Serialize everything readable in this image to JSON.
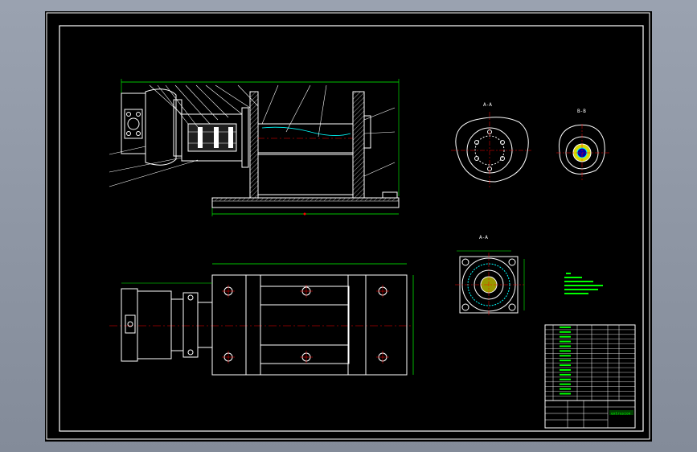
{
  "sheet": {
    "background": "#000000",
    "frame_color": "#ffffff",
    "outline_color": "#ffffff",
    "dimension_color": "#00ff00",
    "centerline_color": "#ff0000",
    "hatch_color": "#ffffff",
    "section_color": "#00ffff",
    "note_color": "#00ff00"
  },
  "views": {
    "section_view_a_label": "A-A",
    "section_view_b_label": "B-B",
    "bearing_view_label": "A-A"
  },
  "title_block": {
    "name_cell_text": "extrusion"
  }
}
